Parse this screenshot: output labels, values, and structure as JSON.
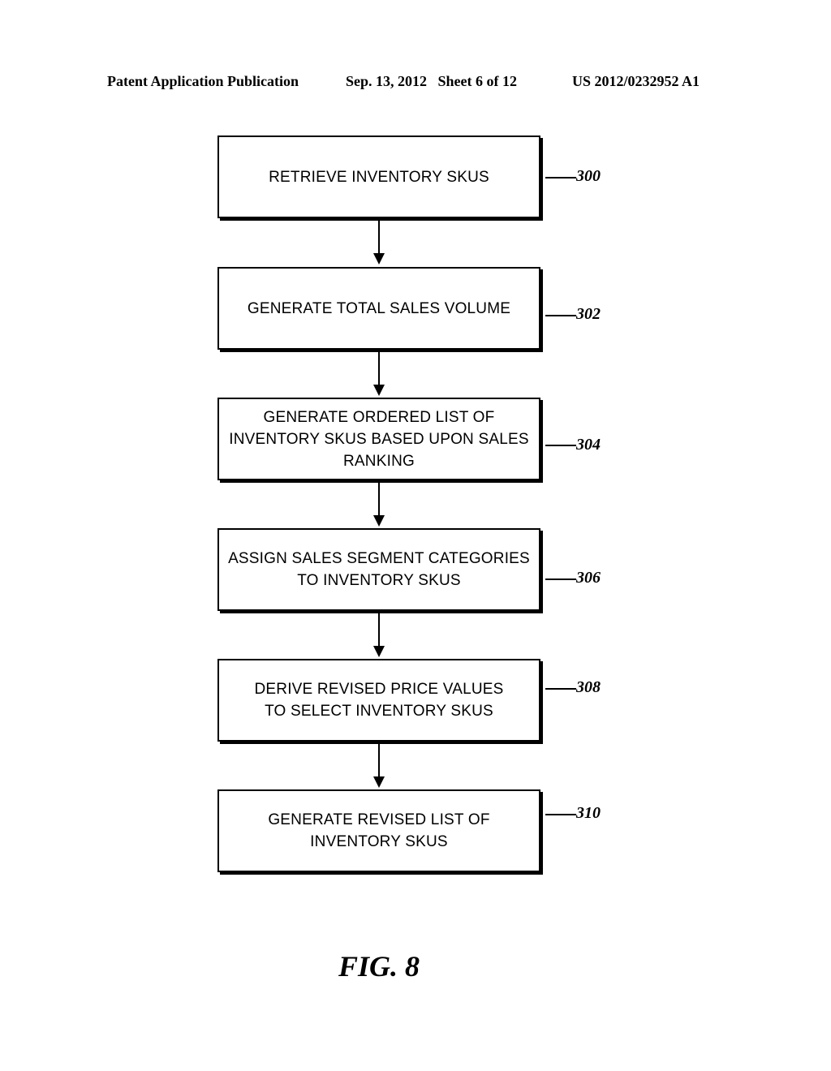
{
  "header": {
    "left": "Patent Application Publication",
    "middle": "Sep. 13, 2012   Sheet 6 of 12",
    "right": "US 2012/0232952 A1"
  },
  "steps": [
    {
      "text": "RETRIEVE INVENTORY SKUS",
      "ref": "300"
    },
    {
      "text": "GENERATE TOTAL SALES VOLUME",
      "ref": "302"
    },
    {
      "text": "GENERATE ORDERED LIST OF INVENTORY SKUS BASED UPON SALES RANKING",
      "ref": "304"
    },
    {
      "text": "ASSIGN SALES SEGMENT CATEGORIES TO INVENTORY SKUS",
      "ref": "306"
    },
    {
      "text": "DERIVE REVISED PRICE VALUES TO SELECT INVENTORY SKUS",
      "ref": "308"
    },
    {
      "text": "GENERATE REVISED LIST OF INVENTORY SKUS",
      "ref": "310"
    }
  ],
  "figure_label": "FIG. 8"
}
